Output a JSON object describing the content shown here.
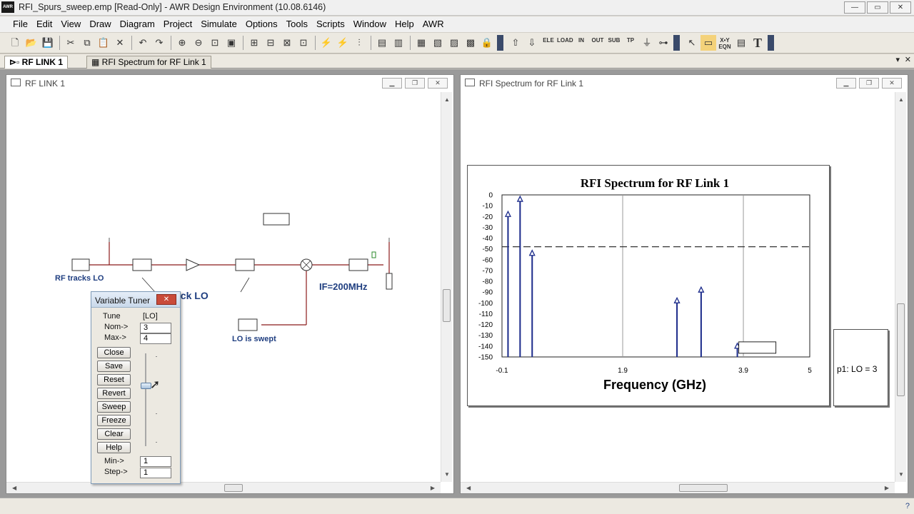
{
  "window": {
    "title": "RFI_Spurs_sweep.emp [Read-Only] - AWR Design Environment (10.08.6146)",
    "app_icon_text": "AWR",
    "minimize": "—",
    "maximize": "▭",
    "close": "✕"
  },
  "menu": [
    "File",
    "Edit",
    "View",
    "Draw",
    "Diagram",
    "Project",
    "Simulate",
    "Options",
    "Tools",
    "Scripts",
    "Window",
    "Help",
    "AWR"
  ],
  "toolbar": {
    "labels_small": [
      "ELE",
      "LOAD",
      "IN",
      "OUT",
      "SUB",
      "TP"
    ],
    "text_tool": "T",
    "xy_label": "X•Y EQN"
  },
  "tabs": [
    {
      "label": "RF LINK 1",
      "active": true
    },
    {
      "label": "RFI Spectrum for RF Link 1",
      "active": false
    }
  ],
  "tab_controls": {
    "dropdown": "▾",
    "close": "✕"
  },
  "schematic": {
    "window_title": "RF LINK 1",
    "labels": {
      "rf_tracks": "RF tracks LO",
      "filters_track": "Filters track LO",
      "if_label": "IF=200MHz",
      "lo_swept": "LO is swept"
    }
  },
  "tuner": {
    "title": "Variable Tuner",
    "close_label": "✕",
    "tune_label": "Tune",
    "var_name": "[LO]",
    "nom_label": "Nom->",
    "nom_value": "3",
    "max_label": "Max->",
    "max_value": "4",
    "buttons": [
      "Close",
      "Save",
      "Reset",
      "Revert",
      "Sweep",
      "Freeze",
      "Clear",
      "Help"
    ],
    "min_label": "Min->",
    "min_value": "1",
    "step_label": "Step->",
    "step_value": "1",
    "slider_value": 3
  },
  "graph_window": {
    "title": "RFI Spectrum for RF Link 1"
  },
  "chart_data": {
    "type": "scatter",
    "title": "RFI Spectrum for RF Link 1",
    "xlabel": "Frequency (GHz)",
    "ylabel": "",
    "xlim": [
      -0.1,
      5
    ],
    "ylim": [
      -150,
      0
    ],
    "xticks": [
      "-0.1",
      "1.9",
      "3.9",
      "5"
    ],
    "yticks": [
      0,
      -10,
      -20,
      -30,
      -40,
      -50,
      -60,
      -70,
      -80,
      -90,
      -100,
      -110,
      -120,
      -130,
      -140,
      -150
    ],
    "threshold": -48,
    "grid": true,
    "spurs": [
      {
        "x": 0.0,
        "y": -18
      },
      {
        "x": 0.2,
        "y": -4
      },
      {
        "x": 0.4,
        "y": -54
      },
      {
        "x": 2.8,
        "y": -98
      },
      {
        "x": 3.2,
        "y": -88
      },
      {
        "x": 3.8,
        "y": -140
      }
    ],
    "legend": "p1: LO = 3"
  }
}
